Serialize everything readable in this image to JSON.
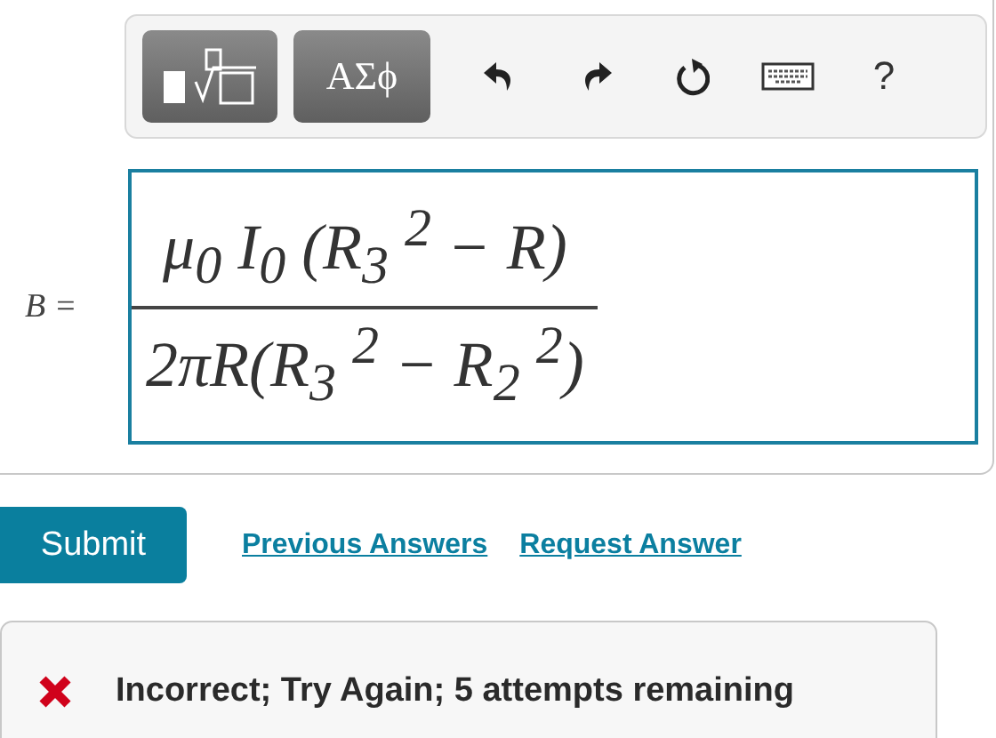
{
  "toolbar": {
    "buttons": [
      {
        "kind": "templates"
      },
      {
        "kind": "symbols",
        "label": "ΑΣϕ"
      },
      {
        "kind": "undo"
      },
      {
        "kind": "redo"
      },
      {
        "kind": "reset"
      },
      {
        "kind": "keyboard"
      },
      {
        "kind": "help",
        "label": "?"
      }
    ]
  },
  "answer": {
    "lhs": "B =",
    "numerator": "μ$_{0}$ I$_{0}$ (R$_{3}$ $^{2}$ − R)",
    "denominator": "2πR(R$_{3}$ $^{2}$ − R$_{2}$ $^{2}$)"
  },
  "actions": {
    "submit": "Submit",
    "links": [
      "Previous Answers",
      "Request Answer"
    ]
  },
  "feedback": {
    "correct": false,
    "message": "Incorrect; Try Again; 5 attempts remaining"
  }
}
